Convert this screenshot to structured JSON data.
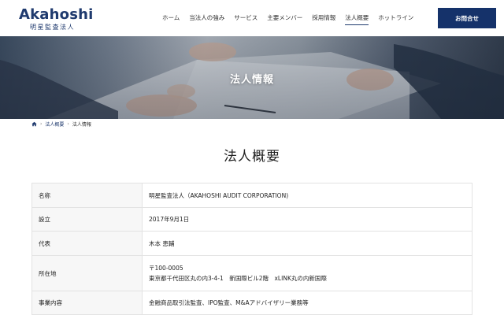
{
  "logo": {
    "main": "Akahoshi",
    "sub": "明星監査法人"
  },
  "nav": {
    "items": [
      {
        "label": "ホーム"
      },
      {
        "label": "当法人の強み"
      },
      {
        "label": "サービス"
      },
      {
        "label": "主要メンバー"
      },
      {
        "label": "採用情報"
      },
      {
        "label": "法人概要"
      },
      {
        "label": "ホットライン"
      }
    ],
    "active_index": 5,
    "contact_label": "お問合せ"
  },
  "hero": {
    "title": "法人情報"
  },
  "breadcrumb": {
    "icon": "home-icon",
    "items": [
      "法人概要",
      "法人情報"
    ]
  },
  "page_title": "法人概要",
  "info": {
    "rows": [
      {
        "label": "名称",
        "lines": [
          "明星監査法人（AKAHOSHI AUDIT CORPORATION)"
        ]
      },
      {
        "label": "設立",
        "lines": [
          "2017年9月1日"
        ]
      },
      {
        "label": "代表",
        "lines": [
          "木本 恵輔"
        ]
      },
      {
        "label": "所在地",
        "lines": [
          "〒100-0005",
          "東京都千代田区丸の内3-4-1　新国際ビル2階　xLINK丸の内新国際"
        ]
      },
      {
        "label": "事業内容",
        "lines": [
          "金融商品取引法監査、IPO監査、M&Aアドバイザリー業務等"
        ]
      }
    ]
  },
  "colors": {
    "brand": "#1f3a6e",
    "button": "#15326a"
  }
}
